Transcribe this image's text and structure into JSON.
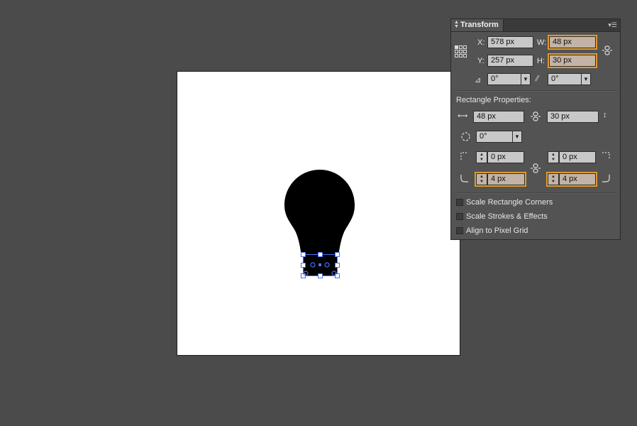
{
  "panel": {
    "title": "Transform",
    "x": "578 px",
    "y": "257 px",
    "w": "48 px",
    "h": "30 px",
    "rotate": "0°",
    "shear": "0°",
    "labels": {
      "x": "X:",
      "y": "Y:",
      "w": "W:",
      "h": "H:"
    }
  },
  "rect_props": {
    "heading": "Rectangle Properties:",
    "width": "48 px",
    "height": "30 px",
    "rotation": "0°",
    "corner_tl": "0 px",
    "corner_tr": "0 px",
    "corner_bl": "4 px",
    "corner_br": "4 px"
  },
  "options": [
    {
      "label": "Scale Rectangle Corners",
      "checked": false
    },
    {
      "label": "Scale Strokes & Effects",
      "checked": false
    },
    {
      "label": "Align to Pixel Grid",
      "checked": false
    }
  ],
  "colors": {
    "highlight": "#e09b2d",
    "selection": "#4a6ef5"
  },
  "icons": {
    "reference_point": "reference-point-grid-icon",
    "link": "link-proportions-icon",
    "rotate": "rotate-angle-icon",
    "shear": "shear-angle-icon"
  }
}
